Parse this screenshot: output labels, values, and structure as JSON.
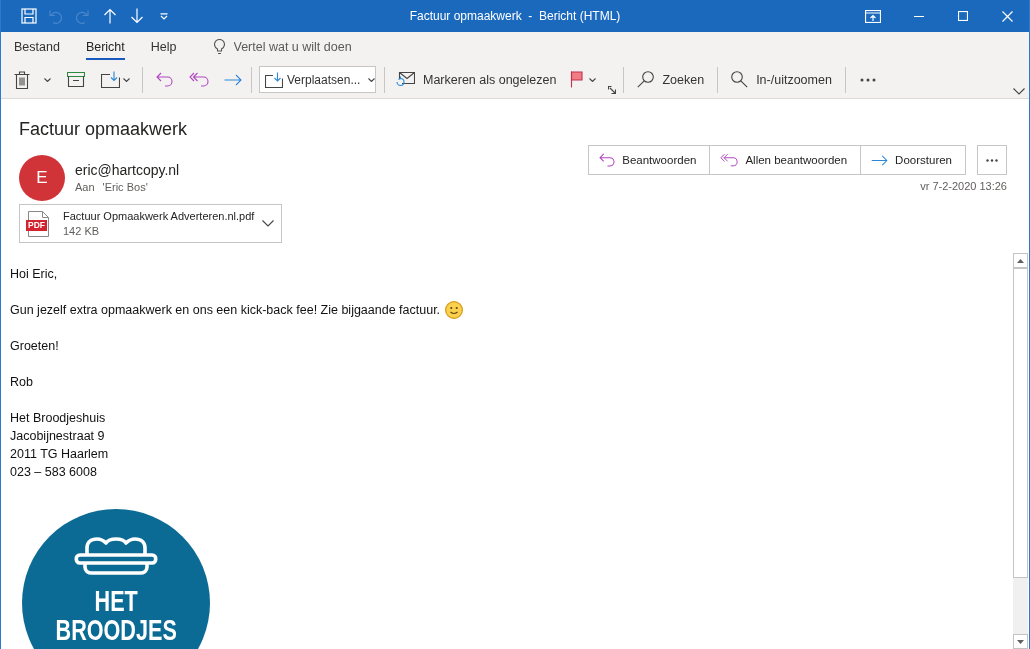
{
  "window": {
    "title": "Factuur opmaakwerk  -  Bericht (HTML)"
  },
  "quick_access": [
    {
      "kind": "save",
      "disabled": false
    },
    {
      "kind": "undo",
      "disabled": true
    },
    {
      "kind": "redo",
      "disabled": true
    },
    {
      "kind": "previous",
      "disabled": false
    },
    {
      "kind": "next",
      "disabled": false
    },
    {
      "kind": "customize",
      "disabled": false
    }
  ],
  "ribbon": {
    "tabs": [
      {
        "label": "Bestand",
        "selected": false
      },
      {
        "label": "Bericht",
        "selected": true
      },
      {
        "label": "Help",
        "selected": false
      }
    ],
    "tell_me": {
      "placeholder": "Vertel wat u wilt doen"
    },
    "quick_steps": {
      "value": "Verplaatsen..."
    },
    "mark_unread": "Markeren als ongelezen",
    "find": "Zoeken",
    "zoom": "In-/uitzoomen"
  },
  "message": {
    "subject": "Factuur opmaakwerk",
    "sender": {
      "initial": "E",
      "address": "eric@hartcopy.nl"
    },
    "recipient": {
      "label": "Aan",
      "name": "'Eric Bos'"
    },
    "attachment": {
      "badge": "PDF",
      "name": "Factuur Opmaakwerk Adverteren.nl.pdf",
      "size": "142 KB"
    },
    "actions": [
      {
        "kind": "reply",
        "label": "Beantwoorden"
      },
      {
        "kind": "reply_all",
        "label": "Allen beantwoorden"
      },
      {
        "kind": "forward",
        "label": "Doorsturen"
      }
    ],
    "date": "vr 7-2-2020 13:26"
  },
  "body": {
    "paragraphs": [
      {
        "lines": [
          "Hoi Eric,"
        ],
        "smiley": false
      },
      {
        "lines": [
          "Gun jezelf extra opmaakwerk en ons een kick-back fee! Zie bijgaande factuur."
        ],
        "smiley": true
      },
      {
        "lines": [
          "Groeten!"
        ],
        "smiley": false
      },
      {
        "lines": [
          "Rob"
        ],
        "smiley": false
      },
      {
        "lines": [
          "Het Broodjeshuis",
          "Jacobijnestraat 9",
          "2011 TG Haarlem",
          "023 – 583 6008"
        ],
        "smiley": false
      }
    ],
    "logo": {
      "lines": [
        "HET",
        "BROODJES"
      ]
    }
  }
}
